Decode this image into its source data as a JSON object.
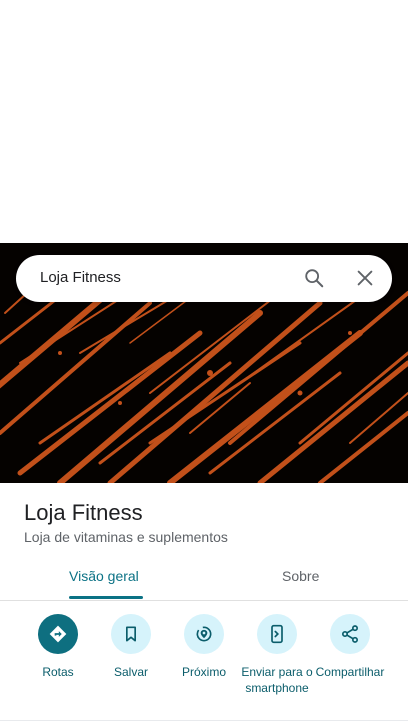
{
  "search": {
    "query": "Loja Fitness"
  },
  "place": {
    "name": "Loja Fitness",
    "category": "Loja de vitaminas e suplementos"
  },
  "tabs": [
    {
      "label": "Visão geral",
      "selected": true
    },
    {
      "label": "Sobre",
      "selected": false
    }
  ],
  "actions": [
    {
      "label": "Rotas",
      "icon": "directions-icon"
    },
    {
      "label": "Salvar",
      "icon": "bookmark-icon"
    },
    {
      "label": "Próximo",
      "icon": "nearby-icon"
    },
    {
      "label": "Enviar para o smartphone",
      "icon": "send-to-phone-icon"
    },
    {
      "label": "Compartilhar",
      "icon": "share-icon"
    }
  ],
  "colors": {
    "accent": "#0b7285",
    "primary_action": "#0e6f80",
    "action_bg": "#d6f3fb",
    "hero_paint": "#c2501a"
  }
}
